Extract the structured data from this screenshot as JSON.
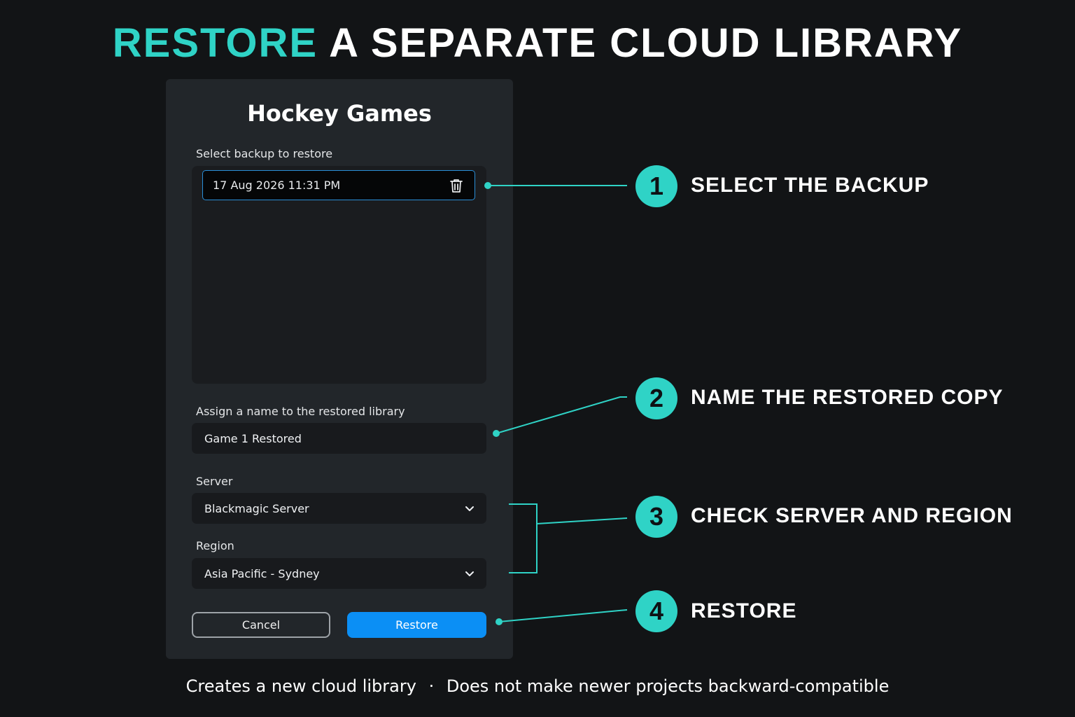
{
  "headline": {
    "accent": "RESTORE",
    "rest": "A SEPARATE CLOUD LIBRARY"
  },
  "dialog": {
    "title": "Hockey Games",
    "backup_label": "Select backup to restore",
    "backups": [
      {
        "label": "17 Aug 2026 11:31 PM",
        "selected": true
      }
    ],
    "name_label": "Assign a name to the restored library",
    "name_value": "Game 1 Restored",
    "server_label": "Server",
    "server_value": "Blackmagic Server",
    "region_label": "Region",
    "region_value": "Asia Pacific - Sydney",
    "cancel_label": "Cancel",
    "restore_label": "Restore"
  },
  "steps": [
    {
      "number": "1",
      "label": "SELECT THE BACKUP"
    },
    {
      "number": "2",
      "label": "NAME THE RESTORED COPY"
    },
    {
      "number": "3",
      "label": "CHECK SERVER AND REGION"
    },
    {
      "number": "4",
      "label": "RESTORE"
    }
  ],
  "footer": {
    "left": "Creates a new cloud library",
    "separator": "·",
    "right": "Does not make newer projects backward-compatible"
  },
  "colors": {
    "accent": "#2fd3c6",
    "primary_button": "#0b8ff5",
    "selection_border": "#2a8fd8",
    "background": "#121416",
    "dialog": "#22262a"
  },
  "icons": {
    "backup_delete": "trash-icon",
    "dropdown": "chevron-down-icon"
  }
}
